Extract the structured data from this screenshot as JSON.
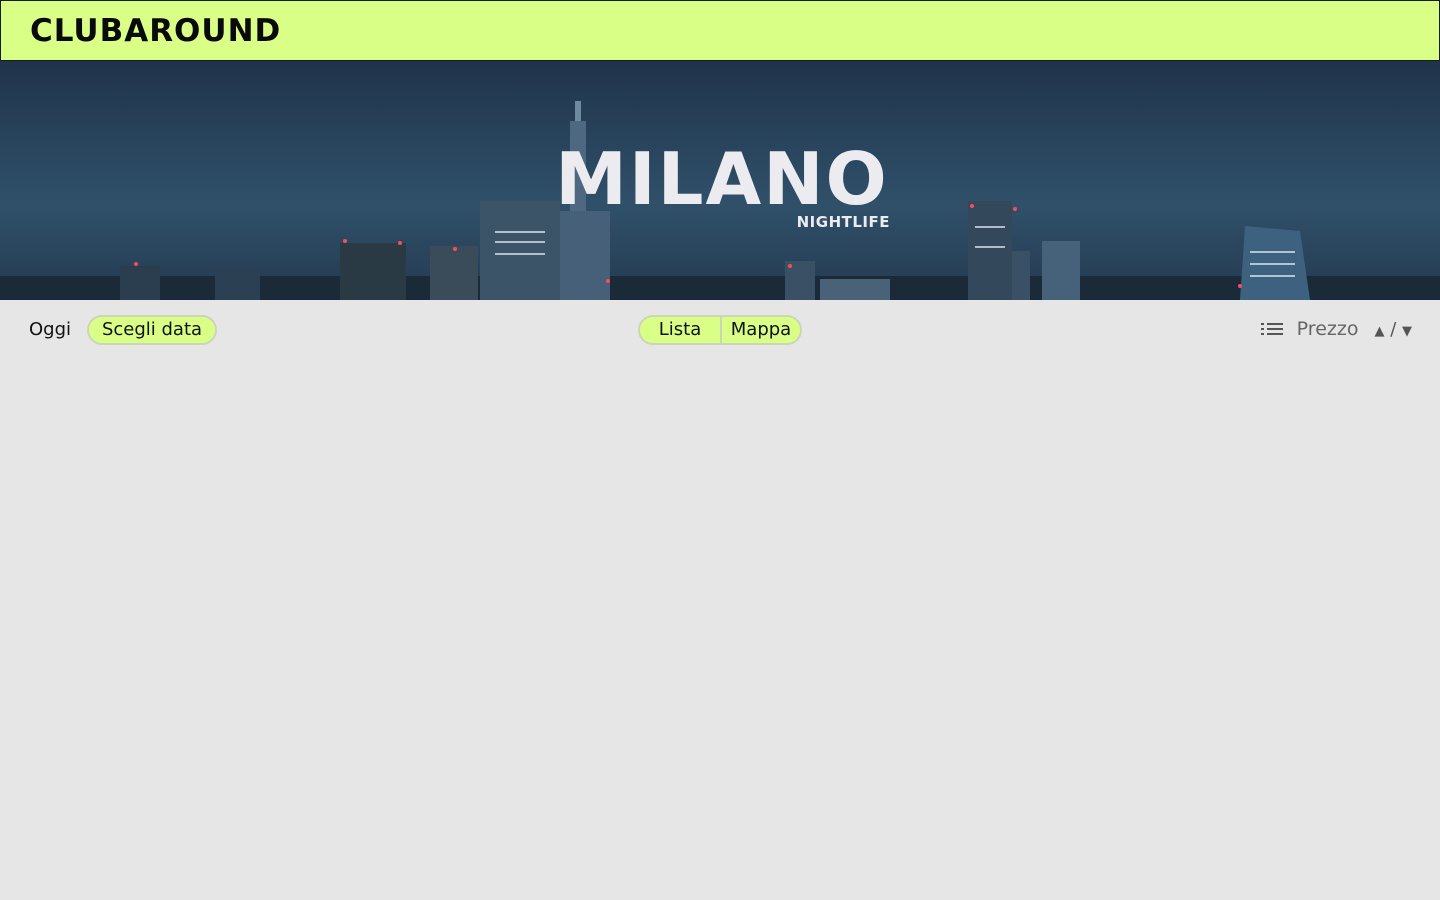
{
  "header": {
    "logo_text": "CLUBAROUND",
    "bg_color": "#d9ff87"
  },
  "hero": {
    "title": "MILANO",
    "subtitle": "NIGHTLIFE",
    "image": "milan-night-skyline"
  },
  "toolbar": {
    "today_label": "Oggi",
    "choose_date_label": "Scegli data",
    "view_toggle": {
      "list_label": "Lista",
      "map_label": "Mappa"
    },
    "sort": {
      "icon": "list-sort-icon",
      "label": "Prezzo",
      "asc_symbol": "▲",
      "separator": "/",
      "desc_symbol": "▼"
    }
  },
  "colors": {
    "accent": "#d9ff87",
    "page_bg": "#e6e6e6",
    "pill_border": "#cbd6b8"
  }
}
